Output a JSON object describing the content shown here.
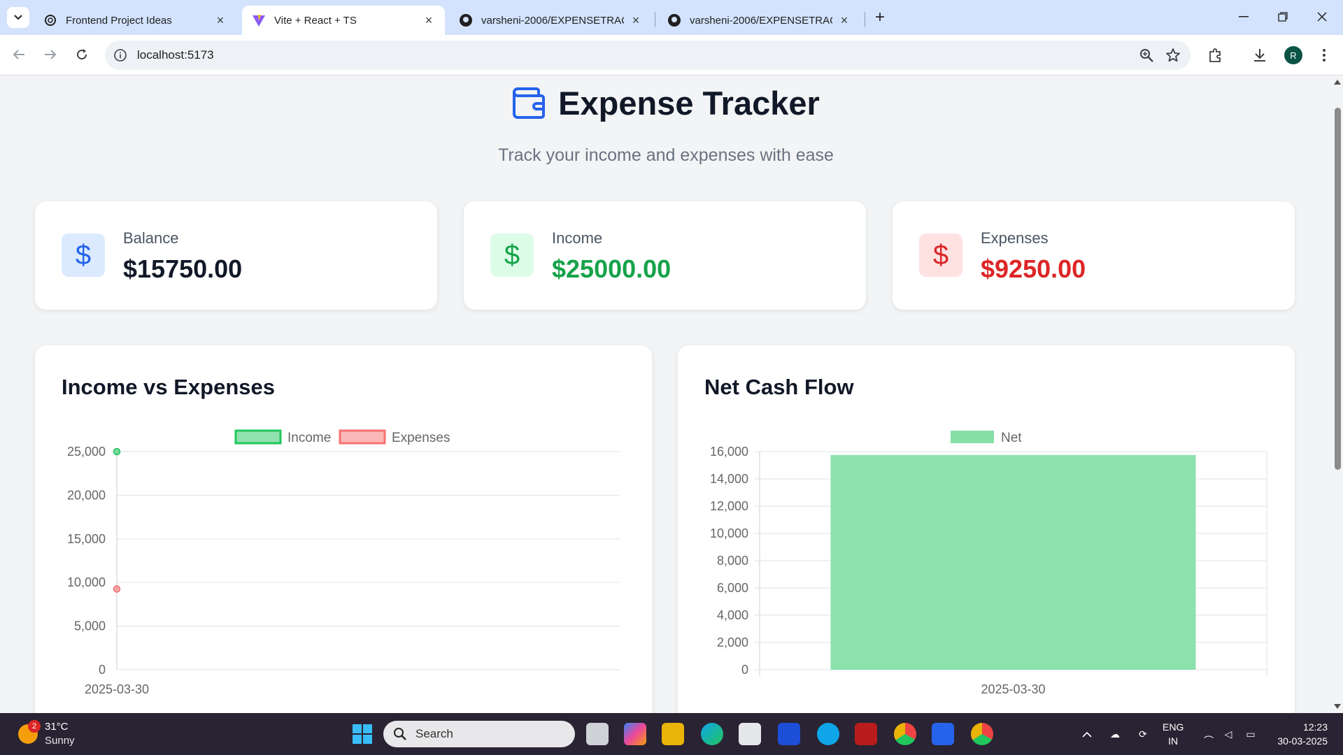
{
  "browser": {
    "tabs": [
      {
        "title": "Frontend Project Ideas",
        "active": false
      },
      {
        "title": "Vite + React + TS",
        "active": true
      },
      {
        "title": "varsheni-2006/EXPENSETRACKER",
        "active": false
      },
      {
        "title": "varsheni-2006/EXPENSETRACKER",
        "active": false
      }
    ],
    "url": "localhost:5173",
    "profile_initial": "R"
  },
  "page": {
    "title": "Expense Tracker",
    "subtitle": "Track your income and expenses with ease",
    "stats": [
      {
        "label": "Balance",
        "value": "$15750.00",
        "color": "#111827",
        "icon_bg": "#dbeafe",
        "icon_color": "#2563eb"
      },
      {
        "label": "Income",
        "value": "$25000.00",
        "color": "#16a34a",
        "icon_bg": "#dcfce7",
        "icon_color": "#16a34a"
      },
      {
        "label": "Expenses",
        "value": "$9250.00",
        "color": "#dc2626",
        "icon_bg": "#fee2e2",
        "icon_color": "#dc2626"
      }
    ],
    "charts": {
      "income_vs_expenses": {
        "title": "Income vs Expenses"
      },
      "net_cash_flow": {
        "title": "Net Cash Flow"
      }
    }
  },
  "chart_data": [
    {
      "type": "line",
      "title": "Income vs Expenses",
      "x": [
        "2025-03-30"
      ],
      "series": [
        {
          "name": "Income",
          "values": [
            25000
          ],
          "color": "#22c55e"
        },
        {
          "name": "Expenses",
          "values": [
            9250
          ],
          "color": "#f87171"
        }
      ],
      "yticks": [
        "0",
        "5,000",
        "10,000",
        "15,000",
        "20,000",
        "25,000"
      ],
      "ylim": [
        0,
        25000
      ],
      "grid": true,
      "legend": "top"
    },
    {
      "type": "bar",
      "title": "Net Cash Flow",
      "categories": [
        "2025-03-30"
      ],
      "series": [
        {
          "name": "Net",
          "values": [
            15750
          ],
          "color": "#86e0a6"
        }
      ],
      "yticks": [
        "0",
        "2,000",
        "4,000",
        "6,000",
        "8,000",
        "10,000",
        "12,000",
        "14,000",
        "16,000"
      ],
      "ylim": [
        0,
        16000
      ],
      "grid": true,
      "legend": "top"
    }
  ],
  "taskbar": {
    "weather_temp": "31°C",
    "weather_cond": "Sunny",
    "weather_badge": "2",
    "search_label": "Search",
    "lang_line1": "ENG",
    "lang_line2": "IN",
    "time": "12:23",
    "date": "30-03-2025"
  }
}
